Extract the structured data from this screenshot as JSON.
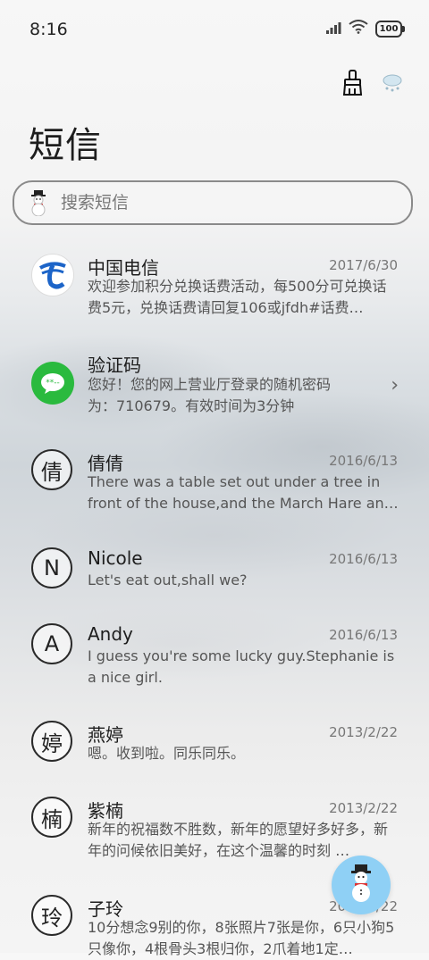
{
  "status_bar": {
    "time": "8:16",
    "battery": "100",
    "icons": [
      "signal-icon",
      "wifi-icon",
      "battery-icon"
    ]
  },
  "top_actions": [
    "cleanup-brush-icon",
    "weather-snow-icon"
  ],
  "page_title": "短信",
  "search": {
    "placeholder": "搜索短信",
    "icon": "snowman-icon"
  },
  "messages": [
    {
      "avatar": "",
      "avatar_type": "china-telecom-logo",
      "sender": "中国电信",
      "date": "2017/6/30",
      "preview": "欢迎参加积分兑换话费活动，每500分可兑换话费5元，兑换话费请回复106或jfdh#话费…"
    },
    {
      "avatar": "",
      "avatar_type": "message-bubble-icon",
      "sender": "验证码",
      "date": "",
      "preview": "您好！您的网上营业厅登录的随机密码为：710679。有效时间为3分钟"
    },
    {
      "avatar": "倩",
      "avatar_type": "text",
      "sender": "倩倩",
      "date": "2016/6/13",
      "preview": "There was a table set out under a tree in front of the house,and the March Hare an…"
    },
    {
      "avatar": "N",
      "avatar_type": "text",
      "sender": "Nicole",
      "date": "2016/6/13",
      "preview": "Let's eat out,shall we?"
    },
    {
      "avatar": "A",
      "avatar_type": "text",
      "sender": "Andy",
      "date": "2016/6/13",
      "preview": "I guess you're some lucky guy.Stephanie is a nice girl."
    },
    {
      "avatar": "婷",
      "avatar_type": "text",
      "sender": "燕婷",
      "date": "2013/2/22",
      "preview": "嗯。收到啦。同乐同乐。"
    },
    {
      "avatar": "楠",
      "avatar_type": "text",
      "sender": "紫楠",
      "date": "2013/2/22",
      "preview": "新年的祝福数不胜数，新年的愿望好多好多，新年的问候依旧美好，在这个温馨的时刻 …"
    },
    {
      "avatar": "玲",
      "avatar_type": "text",
      "sender": "子玲",
      "date": "2013/2/22",
      "preview": "10分想念9别的你，8张照片7张是你，6只小狗5只像你，4根骨头3根归你，2爪着地1定…"
    }
  ],
  "fab": {
    "icon": "snowman-icon"
  },
  "colors": {
    "wechat_green": "#2aba3e",
    "telecom_blue": "#1c64c8",
    "fab_blue": "#8fd0f5"
  }
}
